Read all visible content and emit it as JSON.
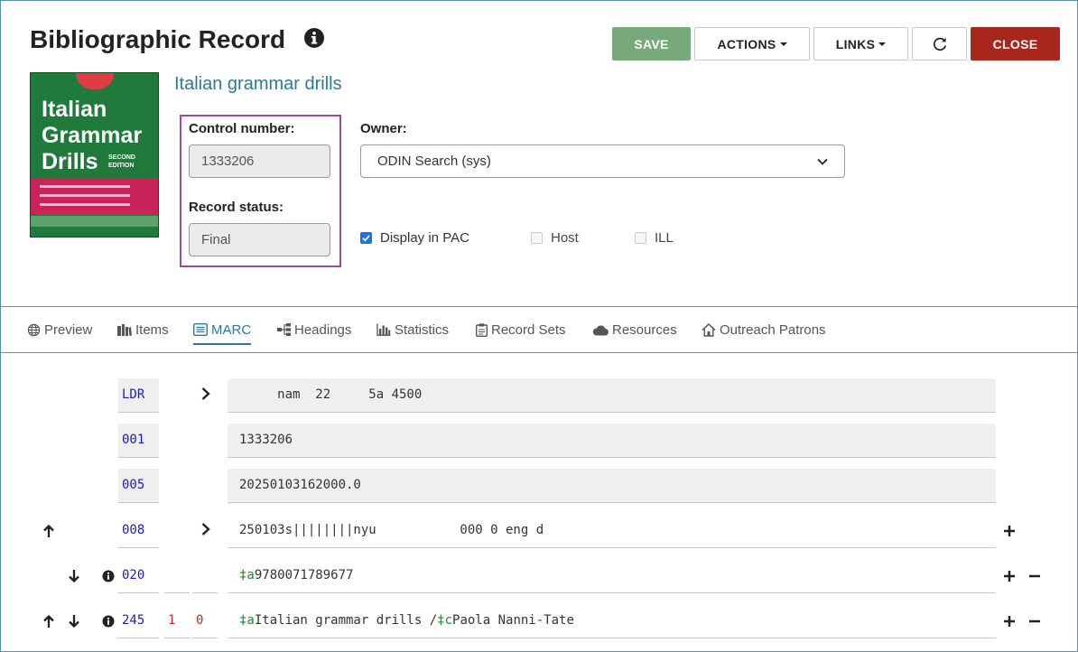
{
  "header": {
    "title": "Bibliographic Record",
    "buttons": {
      "save": "SAVE",
      "actions": "ACTIONS",
      "links": "LINKS",
      "close": "CLOSE"
    }
  },
  "cover": {
    "title_lines": [
      "Italian",
      "Grammar",
      "Drills"
    ],
    "edition_lines": [
      "SECOND",
      "EDITION"
    ]
  },
  "record": {
    "title": "Italian grammar drills",
    "control_number_label": "Control number:",
    "control_number": "1333206",
    "record_status_label": "Record status:",
    "record_status": "Final",
    "owner_label": "Owner:",
    "owner_value": "ODIN Search (sys)",
    "checkboxes": [
      {
        "label": "Display in PAC",
        "checked": true,
        "enabled": true
      },
      {
        "label": "Host",
        "checked": false,
        "enabled": false
      },
      {
        "label": "ILL",
        "checked": false,
        "enabled": false
      }
    ]
  },
  "tabs": [
    {
      "label": "Preview",
      "icon": "globe-icon",
      "active": false
    },
    {
      "label": "Items",
      "icon": "items-icon",
      "active": false
    },
    {
      "label": "MARC",
      "icon": "list-icon",
      "active": true
    },
    {
      "label": "Headings",
      "icon": "sitemap-icon",
      "active": false
    },
    {
      "label": "Statistics",
      "icon": "bar-chart-icon",
      "active": false
    },
    {
      "label": "Record Sets",
      "icon": "clipboard-icon",
      "active": false
    },
    {
      "label": "Resources",
      "icon": "cloud-icon",
      "active": false
    },
    {
      "label": "Outreach Patrons",
      "icon": "home-icon",
      "active": false
    }
  ],
  "marc": {
    "rows": [
      {
        "tag": "LDR",
        "content": "     nam  22     5a 4500"
      },
      {
        "tag": "001",
        "content": "1333206"
      },
      {
        "tag": "005",
        "content": "20250103162000.0"
      },
      {
        "tag": "008",
        "content": "250103s||||||||nyu           000 0 eng d"
      },
      {
        "tag": "020",
        "ind1": "",
        "ind2": "",
        "subfields": [
          {
            "code": "‡a",
            "text": "9780071789677"
          }
        ]
      },
      {
        "tag": "245",
        "ind1": "1",
        "ind2": "0",
        "subfields": [
          {
            "code": "‡a",
            "text": "Italian grammar drills /"
          },
          {
            "code": "‡c",
            "text": "Paola Nanni-Tate"
          }
        ]
      }
    ]
  }
}
